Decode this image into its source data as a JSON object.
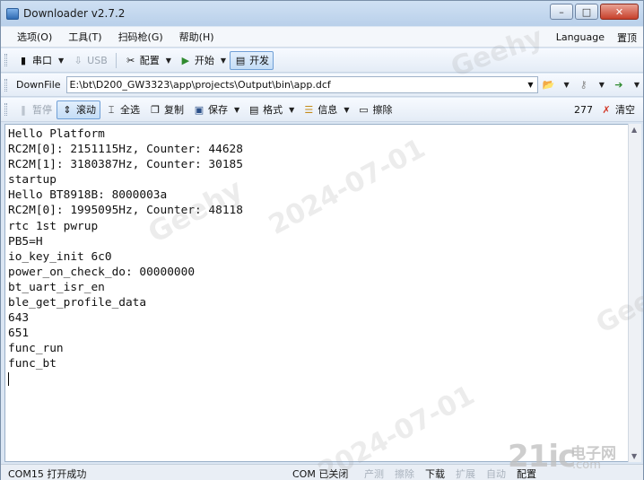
{
  "window": {
    "title": "Downloader v2.7.2",
    "minimize": "–",
    "maximize": "□",
    "close": "✕"
  },
  "menu": {
    "items": [
      "选项(O)",
      "工具(T)",
      "扫码枪(G)",
      "帮助(H)"
    ],
    "right": [
      "Language",
      "置顶"
    ]
  },
  "toolbar1": {
    "serial": "串口",
    "usb": "USB",
    "config": "配置",
    "start": "开始",
    "dev": "开发"
  },
  "toolbar2": {
    "label": "DownFile",
    "path": "E:\\bt\\D200_GW3323\\app\\projects\\Output\\bin\\app.dcf"
  },
  "toolbar3": {
    "pause": "暂停",
    "scroll": "滚动",
    "select_all": "全选",
    "copy": "复制",
    "save": "保存",
    "format": "格式",
    "info": "信息",
    "erase": "擦除",
    "count": "277",
    "clear": "清空"
  },
  "console": {
    "lines": [
      "Hello Platform",
      "RC2M[0]: 2151115Hz, Counter: 44628",
      "RC2M[1]: 3180387Hz, Counter: 30185",
      "startup",
      "Hello BT8918B: 8000003a",
      "RC2M[0]: 1995095Hz, Counter: 48118",
      "rtc 1st pwrup",
      "PB5=H",
      "io_key_init 6c0",
      "power_on_check_do: 00000000",
      "bt_uart_isr_en",
      "ble_get_profile_data",
      "643",
      "651",
      "func_run",
      "func_bt"
    ]
  },
  "status": {
    "left": "COM15 打开成功",
    "mid": "COM 已关闭",
    "actions": [
      {
        "label": "产测",
        "enabled": false
      },
      {
        "label": "擦除",
        "enabled": false
      },
      {
        "label": "下载",
        "enabled": true
      },
      {
        "label": "扩展",
        "enabled": false
      },
      {
        "label": "自动",
        "enabled": false
      },
      {
        "label": "配置",
        "enabled": true
      }
    ]
  },
  "watermarks": {
    "brand": "Geehy",
    "date": "2024-07-01",
    "logo_num": "21ic",
    "logo_cn": "电子网",
    "logo_domain": ".com"
  },
  "colors": {
    "accent": "#6f9fd6",
    "titlebar": "#b9d0ea",
    "clear_icon": "#d23a2a"
  }
}
